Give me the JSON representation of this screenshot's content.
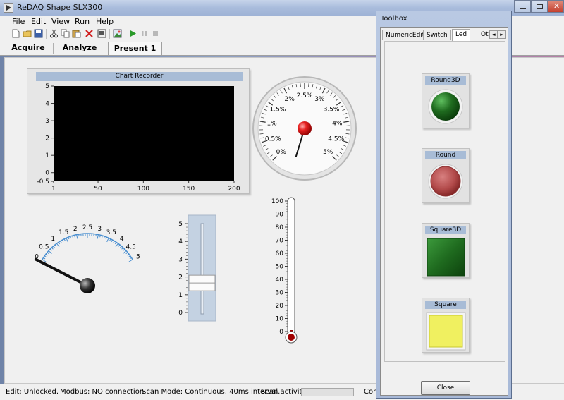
{
  "app": {
    "title": "ReDAQ Shape SLX300"
  },
  "menu": [
    "File",
    "Edit",
    "View",
    "Run",
    "Help"
  ],
  "toolbar_icons": [
    "new-icon",
    "open-icon",
    "save-icon",
    "cut-icon",
    "copy-icon",
    "paste-icon",
    "delete-icon",
    "print-icon",
    "image-icon",
    "run-icon",
    "pause-icon",
    "stop-icon"
  ],
  "mode_tabs": [
    "Acquire",
    "Analyze",
    "Present 1"
  ],
  "active_mode_tab": "Present 1",
  "chart_recorder": {
    "title": "Chart Recorder",
    "y_ticks": [
      "5",
      "4",
      "3",
      "2",
      "1",
      "0",
      "-0.5"
    ],
    "x_ticks": [
      "1",
      "50",
      "100",
      "150",
      "200"
    ],
    "background": "#000000"
  },
  "gauge": {
    "ticks": [
      "0%",
      "0.5%",
      "1%",
      "1.5%",
      "2%",
      "2.5%",
      "3%",
      "3.5%",
      "4%",
      "4.5%",
      "5%"
    ],
    "value": 0
  },
  "meter": {
    "ticks": [
      "0",
      "0.5",
      "1",
      "1.5",
      "2",
      "2.5",
      "3",
      "3.5",
      "4",
      "4.5",
      "5"
    ],
    "value": 0,
    "scale_color": "#4a8fd0"
  },
  "slider": {
    "ticks": [
      "5",
      "4",
      "3",
      "2",
      "1",
      "0"
    ],
    "value": 1.7
  },
  "thermometer": {
    "ticks": [
      "100",
      "90",
      "80",
      "70",
      "60",
      "50",
      "40",
      "30",
      "20",
      "10",
      "0"
    ],
    "value": 0,
    "fluid_color": "#a00000"
  },
  "status": {
    "edit": "Edit: Unlocked.",
    "modbus": "Modbus: NO connection.",
    "scan_mode": "Scan Mode: Continuous, 40ms interval.",
    "scan_activity": "Scan activity:",
    "truncated": "Con"
  },
  "toolbox": {
    "title": "Toolbox",
    "tabs": [
      "NumericEdit",
      "Switch",
      "Led",
      "Oth"
    ],
    "active_tab": "Led",
    "leds": [
      {
        "label": "Round3D",
        "shape": "circle-3d",
        "color": "#1f6b1f"
      },
      {
        "label": "Round",
        "shape": "circle",
        "color": "#b24a4a"
      },
      {
        "label": "Square3D",
        "shape": "square-3d",
        "color": "#1f6b1f"
      },
      {
        "label": "Square",
        "shape": "square",
        "color": "#f0f060"
      }
    ],
    "close_label": "Close"
  }
}
